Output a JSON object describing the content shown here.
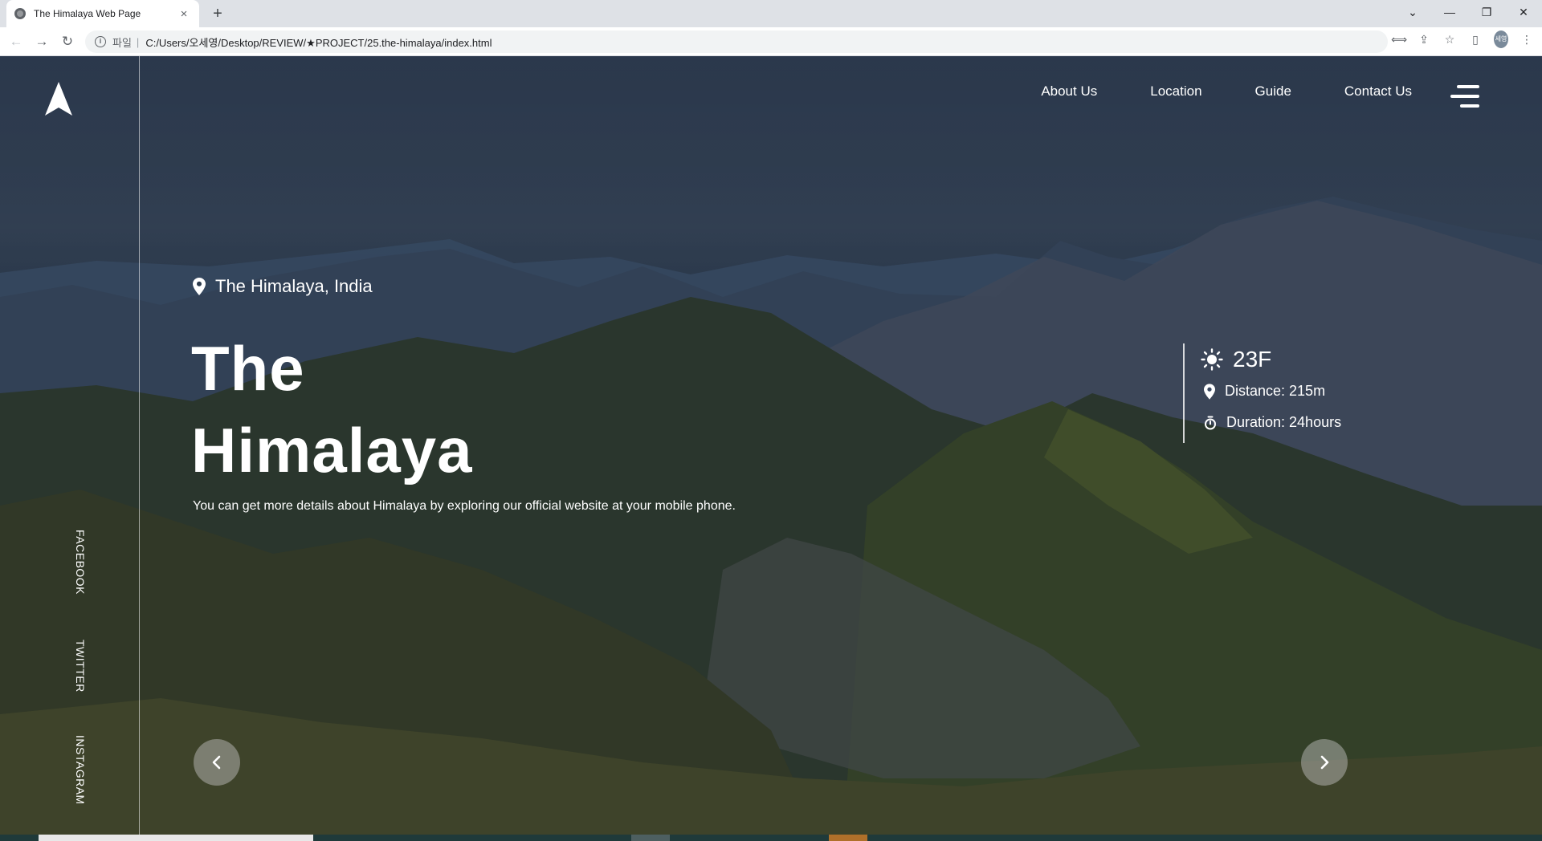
{
  "browser": {
    "tab_title": "The Himalaya Web Page",
    "tab_close": "×",
    "new_tab": "+",
    "protocol_label": "파일",
    "separator": "|",
    "url": "C:/Users/오세영/Desktop/REVIEW/★PROJECT/25.the-himalaya/index.html",
    "profile_initials": "세영"
  },
  "nav": {
    "items": [
      {
        "label": "About Us"
      },
      {
        "label": "Location"
      },
      {
        "label": "Guide"
      },
      {
        "label": "Contact Us"
      }
    ]
  },
  "social": {
    "items": [
      {
        "label": "FACEBOOK"
      },
      {
        "label": "TWITTER"
      },
      {
        "label": "INSTAGRAM"
      }
    ]
  },
  "hero": {
    "location": "The Himalaya, India",
    "title_line1": "The",
    "title_line2": "Himalaya",
    "subtitle": "You can get more details about Himalaya by exploring our official website at your mobile phone."
  },
  "info": {
    "temperature": "23F",
    "distance": "Distance: 215m",
    "duration": "Duration: 24hours"
  },
  "colors": {
    "text": "#ffffff",
    "overlay": "#1b2430",
    "arrow_button_bg": "#c8c8c8"
  }
}
